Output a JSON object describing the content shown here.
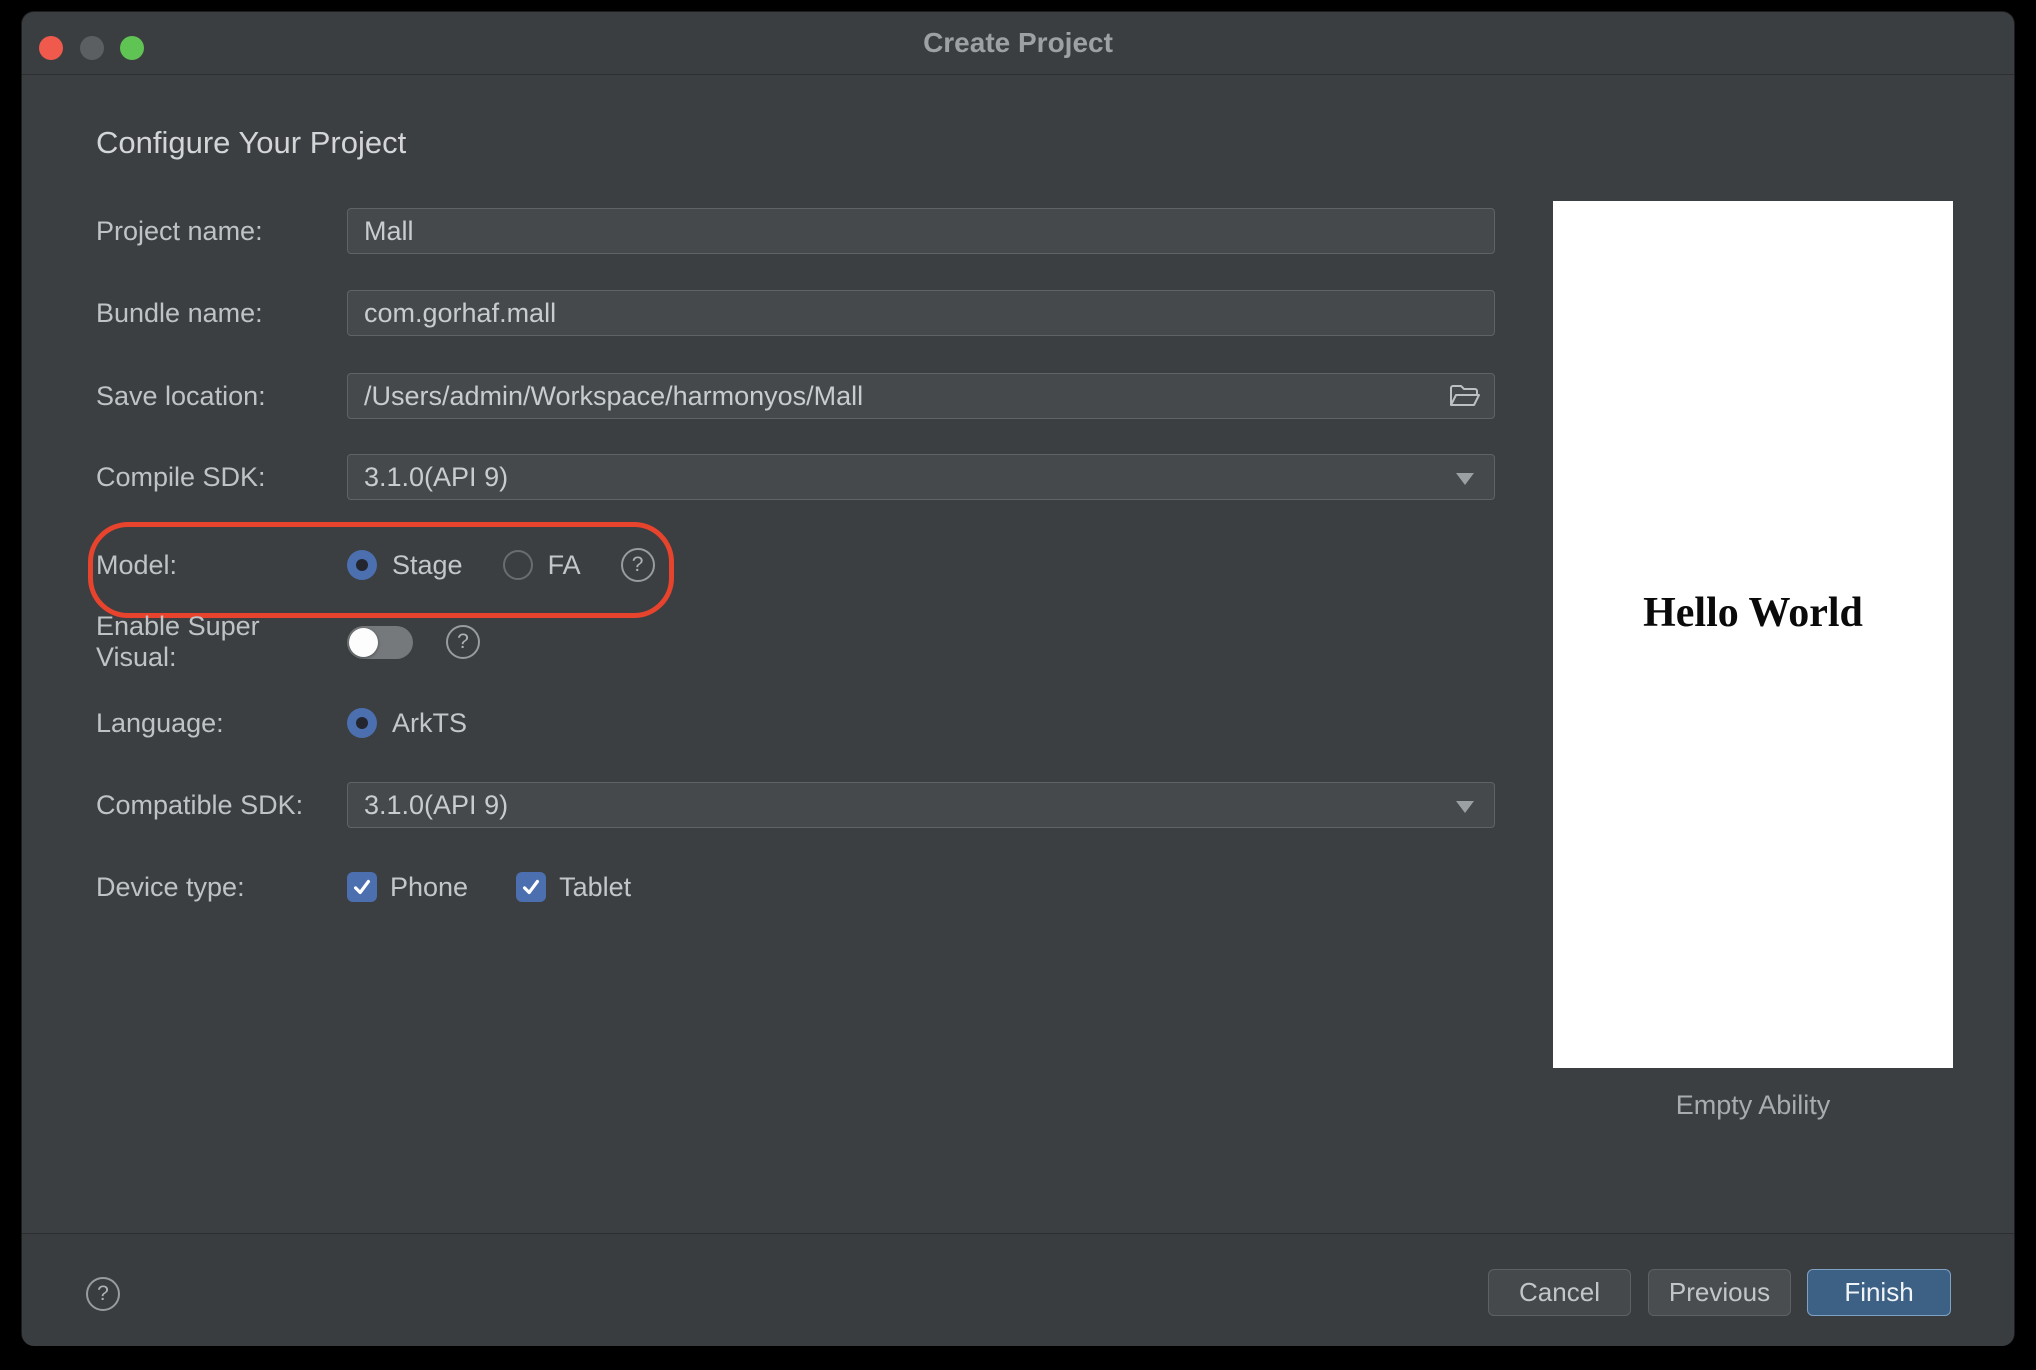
{
  "window": {
    "title": "Create Project"
  },
  "heading": "Configure Your Project",
  "form": {
    "project_name": {
      "label": "Project name:",
      "value": "Mall"
    },
    "bundle_name": {
      "label": "Bundle name:",
      "value": "com.gorhaf.mall"
    },
    "save_location": {
      "label": "Save location:",
      "value": "/Users/admin/Workspace/harmonyos/Mall"
    },
    "compile_sdk": {
      "label": "Compile SDK:",
      "value": "3.1.0(API 9)"
    },
    "model": {
      "label": "Model:",
      "options": [
        {
          "label": "Stage",
          "selected": true
        },
        {
          "label": "FA",
          "selected": false
        }
      ]
    },
    "enable_super_visual": {
      "label": "Enable Super Visual:",
      "enabled": false
    },
    "language": {
      "label": "Language:",
      "options": [
        {
          "label": "ArkTS",
          "selected": true
        }
      ]
    },
    "compatible_sdk": {
      "label": "Compatible SDK:",
      "value": "3.1.0(API 9)"
    },
    "device_type": {
      "label": "Device type:",
      "options": [
        {
          "label": "Phone",
          "checked": true
        },
        {
          "label": "Tablet",
          "checked": true
        }
      ]
    }
  },
  "preview": {
    "screen_text": "Hello World",
    "caption": "Empty Ability"
  },
  "footer": {
    "cancel": "Cancel",
    "previous": "Previous",
    "finish": "Finish"
  },
  "icons": {
    "help_glyph": "?"
  },
  "colors": {
    "dialog_bg": "#3c3f41",
    "field_bg": "#45494b",
    "field_border": "#5f6365",
    "accent_blue": "#4c6fb0",
    "annotation_red": "#e8432d",
    "finish_button": "#3d6185",
    "traffic_close": "#ef5a4c",
    "traffic_minimize": "#5c5f61",
    "traffic_zoom": "#5fc454"
  }
}
